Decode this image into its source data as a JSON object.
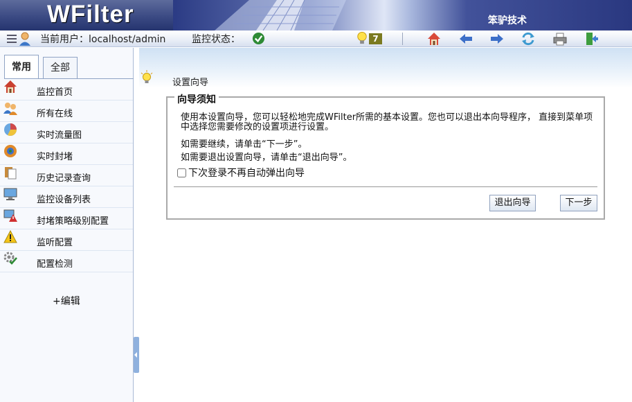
{
  "header": {
    "logo": "WFilter",
    "brand": "笨驴技术"
  },
  "toolbar": {
    "user_label": "当前用户：localhost/admin",
    "status_label": "监控状态：",
    "alert_count": "7",
    "icons": [
      "menu-list-icon",
      "user-icon",
      "status-ok-icon",
      "lightbulb-icon",
      "home-icon",
      "back-arrow-icon",
      "forward-arrow-icon",
      "refresh-icon",
      "print-icon",
      "exit-icon"
    ]
  },
  "sidebar": {
    "tabs": [
      {
        "label": "常用",
        "active": true
      },
      {
        "label": "全部",
        "active": false
      }
    ],
    "items": [
      {
        "label": "监控首页",
        "icon": "home-icon"
      },
      {
        "label": "所有在线",
        "icon": "users-icon"
      },
      {
        "label": "实时流量图",
        "icon": "pie-chart-icon"
      },
      {
        "label": "实时封堵",
        "icon": "block-icon"
      },
      {
        "label": "历史记录查询",
        "icon": "documents-icon"
      },
      {
        "label": "监控设备列表",
        "icon": "monitor-icon"
      },
      {
        "label": "封堵策略级别配置",
        "icon": "policy-warning-icon"
      },
      {
        "label": "监听配置",
        "icon": "warning-icon"
      },
      {
        "label": "配置检测",
        "icon": "gear-check-icon"
      }
    ],
    "edit_label": "+编辑"
  },
  "main": {
    "title": "设置向导",
    "wizard": {
      "legend": "向导须知",
      "intro": "使用本设置向导，您可以轻松地完成WFilter所需的基本设置。您也可以退出本向导程序， 直接到菜单项中选择您需要修改的设置项进行设置。",
      "next_hint": "如需要继续，请单击“下一步”。",
      "exit_hint": "如需要退出设置向导，请单击“退出向导”。",
      "checkbox_label": "下次登录不再自动弹出向导",
      "checkbox_checked": false,
      "exit_button": "退出向导",
      "next_button": "下一步"
    }
  },
  "colors": {
    "header_bg": "#26357a",
    "toolbar_bg": "#e9eef7",
    "sidebar_bg": "#f7f9fd",
    "accent_border": "#8fa3c4",
    "alert_badge": "#7b7a20"
  }
}
